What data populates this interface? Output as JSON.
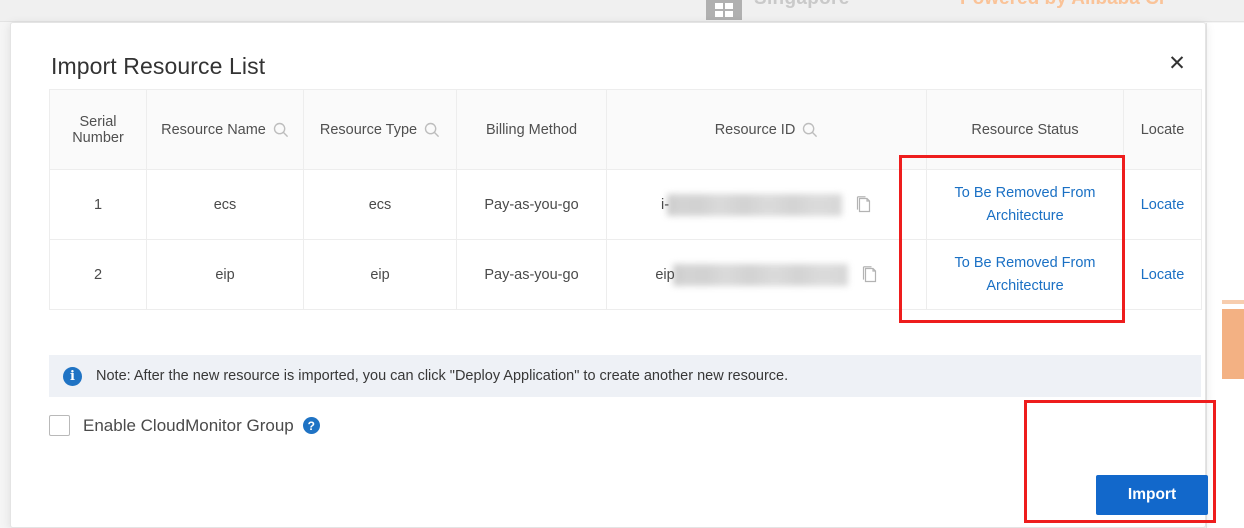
{
  "background": {
    "region_label": "Singapore",
    "powered_by": "Powered by Alibaba Cl",
    "tab_icon": "grid-icon",
    "powered_by_color": "#fac398",
    "side_button_color": "#f3b183"
  },
  "modal": {
    "title": "Import Resource List",
    "close_label": "✕",
    "table": {
      "columns": [
        {
          "label": "Serial Number",
          "searchable": false,
          "key": "serial"
        },
        {
          "label": "Resource Name",
          "searchable": true,
          "key": "name"
        },
        {
          "label": "Resource Type",
          "searchable": true,
          "key": "type"
        },
        {
          "label": "Billing Method",
          "searchable": false,
          "key": "billing"
        },
        {
          "label": "Resource ID",
          "searchable": true,
          "key": "id"
        },
        {
          "label": "Resource Status",
          "searchable": false,
          "key": "status"
        },
        {
          "label": "Locate",
          "searchable": false,
          "key": "locate"
        }
      ],
      "rows": [
        {
          "serial": "1",
          "name": "ecs",
          "type": "ecs",
          "billing": "Pay-as-you-go",
          "id_prefix": "i-",
          "id_redacted": true,
          "status": "To Be Removed From Architecture",
          "locate": "Locate"
        },
        {
          "serial": "2",
          "name": "eip",
          "type": "eip",
          "billing": "Pay-as-you-go",
          "id_prefix": "eip",
          "id_redacted": true,
          "status": "To Be Removed From Architecture",
          "locate": "Locate"
        }
      ]
    },
    "note": {
      "icon": "info-icon",
      "icon_glyph": "i",
      "text": "Note: After the new resource is imported, you can click \"Deploy Application\" to create another new resource."
    },
    "cloudmonitor": {
      "label": "Enable CloudMonitor Group",
      "checked": false,
      "help_glyph": "?"
    },
    "import_button": {
      "label": "Import",
      "color": "#1268cb"
    }
  },
  "annotations": {
    "color": "#ee1d1d",
    "boxes": [
      {
        "name": "status-column-highlight"
      },
      {
        "name": "import-button-highlight"
      }
    ]
  },
  "colors": {
    "link": "#1a70c4",
    "primary": "#1268cb",
    "note_bg": "#eef1f6",
    "annotation_red": "#ee1d1d"
  }
}
